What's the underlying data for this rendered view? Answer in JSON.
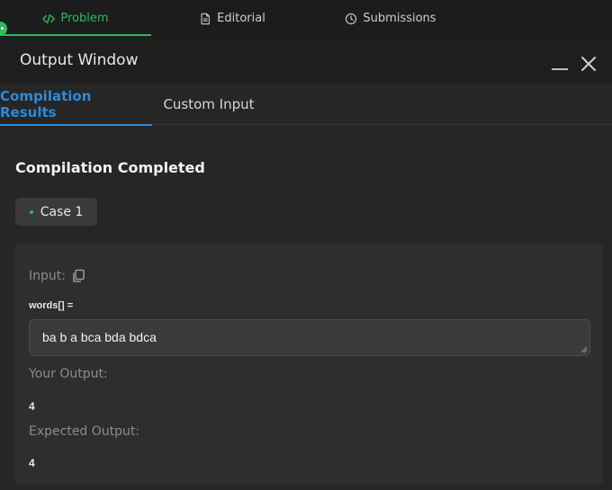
{
  "tabs": [
    {
      "label": "Problem",
      "icon": "code-icon",
      "active": true
    },
    {
      "label": "Editorial",
      "icon": "document-icon",
      "active": false
    },
    {
      "label": "Submissions",
      "icon": "clock-icon",
      "active": false
    }
  ],
  "output_window": {
    "title": "Output Window",
    "subtabs": [
      {
        "label": "Compilation Results",
        "active": true
      },
      {
        "label": "Custom Input",
        "active": false
      }
    ],
    "status": "Compilation Completed",
    "case_label": "Case 1",
    "input_label": "Input:",
    "variable_label": "words[] =",
    "input_value": "ba b a bca bda bdca",
    "your_output_label": "Your Output:",
    "your_output_value": "4",
    "expected_output_label": "Expected Output:",
    "expected_output_value": "4"
  },
  "colors": {
    "accent_green": "#2cbb5d",
    "accent_blue": "#2a8bdb",
    "background": "#262626"
  }
}
